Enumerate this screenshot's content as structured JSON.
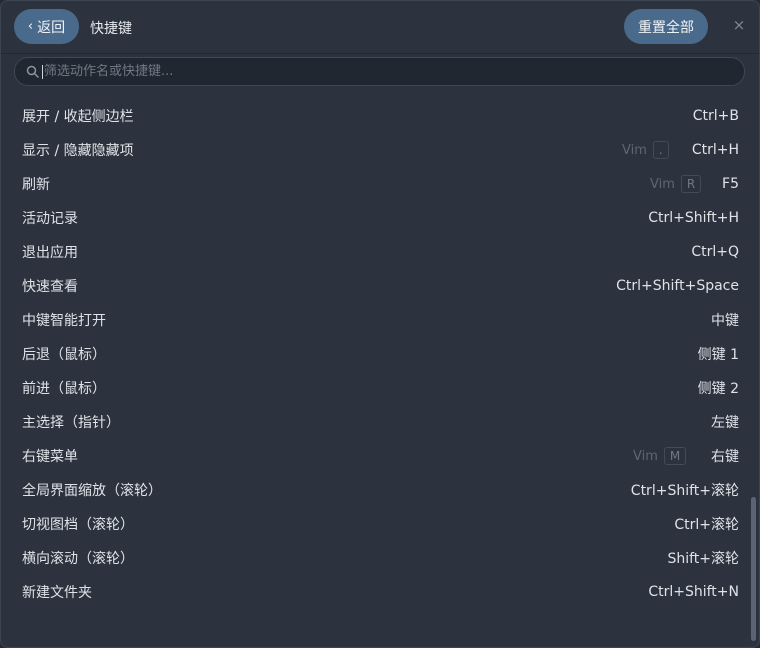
{
  "header": {
    "back_label": "返回",
    "title": "快捷键",
    "reset_label": "重置全部",
    "close_glyph": "×"
  },
  "search": {
    "placeholder": "筛选动作名或快捷键..."
  },
  "shortcuts": [
    {
      "action": "展开 / 收起侧边栏",
      "keys": "Ctrl+B"
    },
    {
      "action": "显示 / 隐藏隐藏项",
      "keys": "Ctrl+H",
      "vim_label": "Vim",
      "vim_key": "."
    },
    {
      "action": "刷新",
      "keys": "F5",
      "vim_label": "Vim",
      "vim_key": "R"
    },
    {
      "action": "活动记录",
      "keys": "Ctrl+Shift+H"
    },
    {
      "action": "退出应用",
      "keys": "Ctrl+Q"
    },
    {
      "action": "快速查看",
      "keys": "Ctrl+Shift+Space"
    },
    {
      "action": "中键智能打开",
      "keys": "中键"
    },
    {
      "action": "后退（鼠标）",
      "keys": "侧键 1"
    },
    {
      "action": "前进（鼠标）",
      "keys": "侧键 2"
    },
    {
      "action": "主选择（指针）",
      "keys": "左键"
    },
    {
      "action": "右键菜单",
      "keys": "右键",
      "vim_label": "Vim",
      "vim_key": "M"
    },
    {
      "action": "全局界面缩放（滚轮）",
      "keys": "Ctrl+Shift+滚轮"
    },
    {
      "action": "切视图档（滚轮）",
      "keys": "Ctrl+滚轮"
    },
    {
      "action": "横向滚动（滚轮）",
      "keys": "Shift+滚轮"
    },
    {
      "action": "新建文件夹",
      "keys": "Ctrl+Shift+N"
    }
  ]
}
